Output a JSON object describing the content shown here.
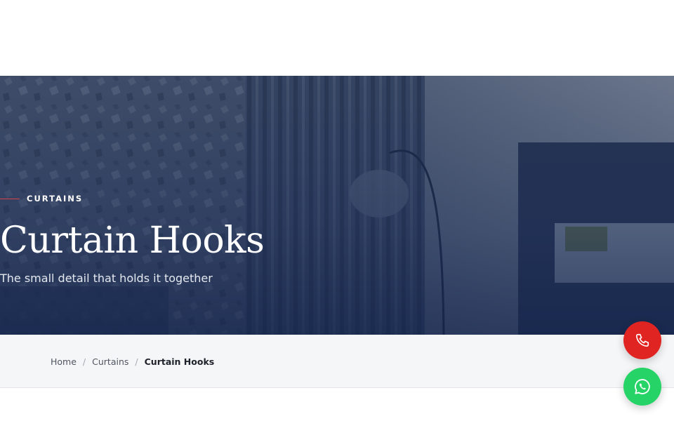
{
  "hero": {
    "eyebrow": "CURTAINS",
    "title": "Curtain Hooks",
    "subtitle": "The small detail that holds it together",
    "accent_color": "#d94545",
    "image": "bedroom-curtains-floor-lamp"
  },
  "breadcrumb": {
    "items": [
      {
        "label": "Home",
        "link": true
      },
      {
        "label": "Curtains",
        "link": true
      },
      {
        "label": "Curtain Hooks",
        "link": false
      }
    ],
    "separator": "/"
  },
  "floating_buttons": [
    {
      "icon": "phone-icon",
      "color": "#e02422"
    },
    {
      "icon": "whatsapp-icon",
      "color": "#25d366"
    }
  ]
}
